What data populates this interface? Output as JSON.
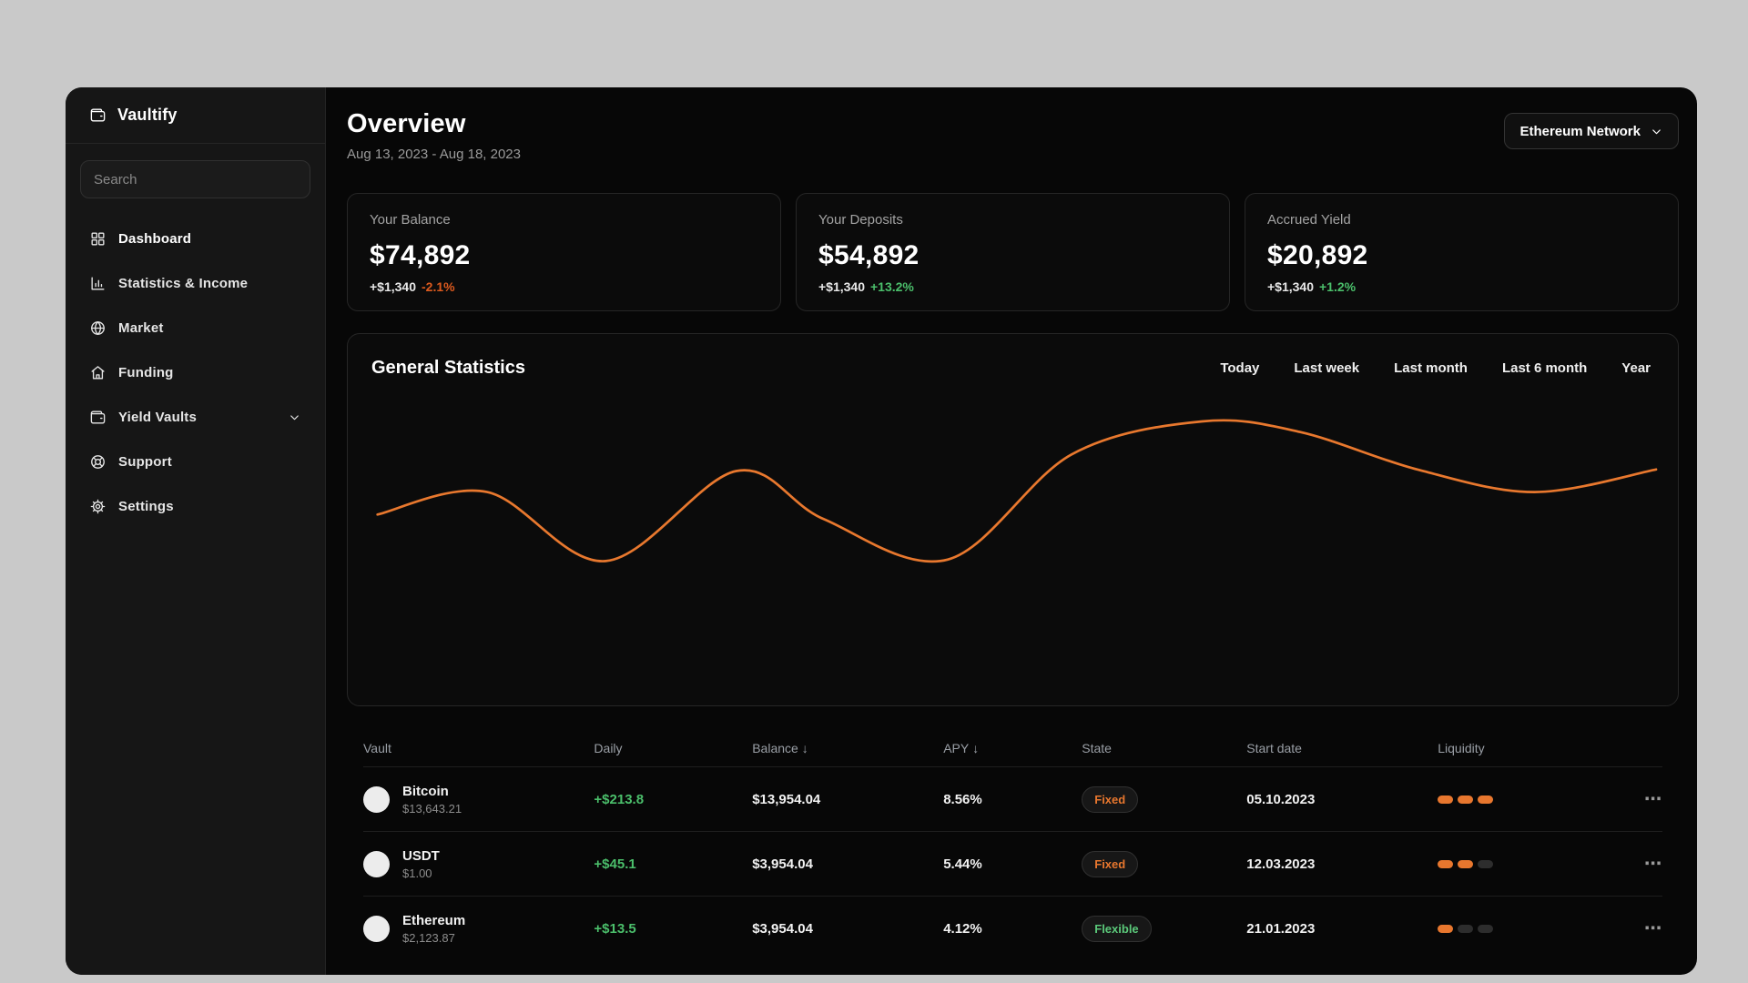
{
  "app": {
    "brand": "Vaultify"
  },
  "sidebar": {
    "search_placeholder": "Search",
    "items": [
      {
        "label": "Dashboard",
        "icon": "dashboard-grid-icon",
        "active": true
      },
      {
        "label": "Statistics & Income",
        "icon": "bar-chart-icon",
        "active": false
      },
      {
        "label": "Market",
        "icon": "globe-icon",
        "active": false
      },
      {
        "label": "Funding",
        "icon": "home-icon",
        "active": false
      },
      {
        "label": "Yield Vaults",
        "icon": "wallet-icon",
        "active": false,
        "has_chevron": true
      },
      {
        "label": "Support",
        "icon": "life-buoy-icon",
        "active": false
      },
      {
        "label": "Settings",
        "icon": "gear-icon",
        "active": false
      }
    ]
  },
  "header": {
    "title": "Overview",
    "date_range": "Aug 13, 2023 - Aug 18, 2023",
    "network_selector": "Ethereum Network"
  },
  "stats": [
    {
      "label": "Your Balance",
      "value": "$74,892",
      "delta": "+$1,340",
      "pct": "-2.1%",
      "direction": "down"
    },
    {
      "label": "Your Deposits",
      "value": "$54,892",
      "delta": "+$1,340",
      "pct": "+13.2%",
      "direction": "up"
    },
    {
      "label": "Accrued Yield",
      "value": "$20,892",
      "delta": "+$1,340",
      "pct": "+1.2%",
      "direction": "up"
    }
  ],
  "chart_panel": {
    "title": "General Statistics",
    "filters": [
      "Today",
      "Last week",
      "Last month",
      "Last 6 month",
      "Year"
    ]
  },
  "chart_data": {
    "type": "line",
    "title": "General Statistics",
    "x_axis": "hidden",
    "y_axis": "hidden",
    "grid": false,
    "legend": false,
    "line_color": "#e8782e",
    "series": [
      {
        "name": "portfolio-value",
        "points_pct": [
          [
            1.3,
            41
          ],
          [
            9.7,
            33.5
          ],
          [
            18.8,
            56.5
          ],
          [
            28.8,
            26.5
          ],
          [
            35.5,
            42.5
          ],
          [
            45,
            56
          ],
          [
            54.5,
            21
          ],
          [
            64.5,
            10
          ],
          [
            72,
            13.5
          ],
          [
            81,
            26
          ],
          [
            90,
            33.5
          ],
          [
            99.3,
            26
          ]
        ]
      }
    ]
  },
  "table": {
    "columns": [
      {
        "label": "Vault"
      },
      {
        "label": "Daily"
      },
      {
        "label": "Balance",
        "sort": "↓"
      },
      {
        "label": "APY",
        "sort": "↓"
      },
      {
        "label": "State"
      },
      {
        "label": "Start date"
      },
      {
        "label": "Liquidity"
      },
      {
        "label": ""
      }
    ],
    "rows": [
      {
        "name": "Bitcoin",
        "price": "$13,643.21",
        "daily": "+$213.8",
        "balance": "$13,954.04",
        "apy": "8.56%",
        "state": "Fixed",
        "state_variant": "fixed",
        "start_date": "05.10.2023",
        "liquidity_level": 3
      },
      {
        "name": "USDT",
        "price": "$1.00",
        "daily": "+$45.1",
        "balance": "$3,954.04",
        "apy": "5.44%",
        "state": "Fixed",
        "state_variant": "fixed",
        "start_date": "12.03.2023",
        "liquidity_level": 2
      },
      {
        "name": "Ethereum",
        "price": "$2,123.87",
        "daily": "+$13.5",
        "balance": "$3,954.04",
        "apy": "4.12%",
        "state": "Flexible",
        "state_variant": "flexible",
        "start_date": "21.01.2023",
        "liquidity_level": 1
      }
    ]
  },
  "ui": {
    "menu_icon": "⋯"
  }
}
